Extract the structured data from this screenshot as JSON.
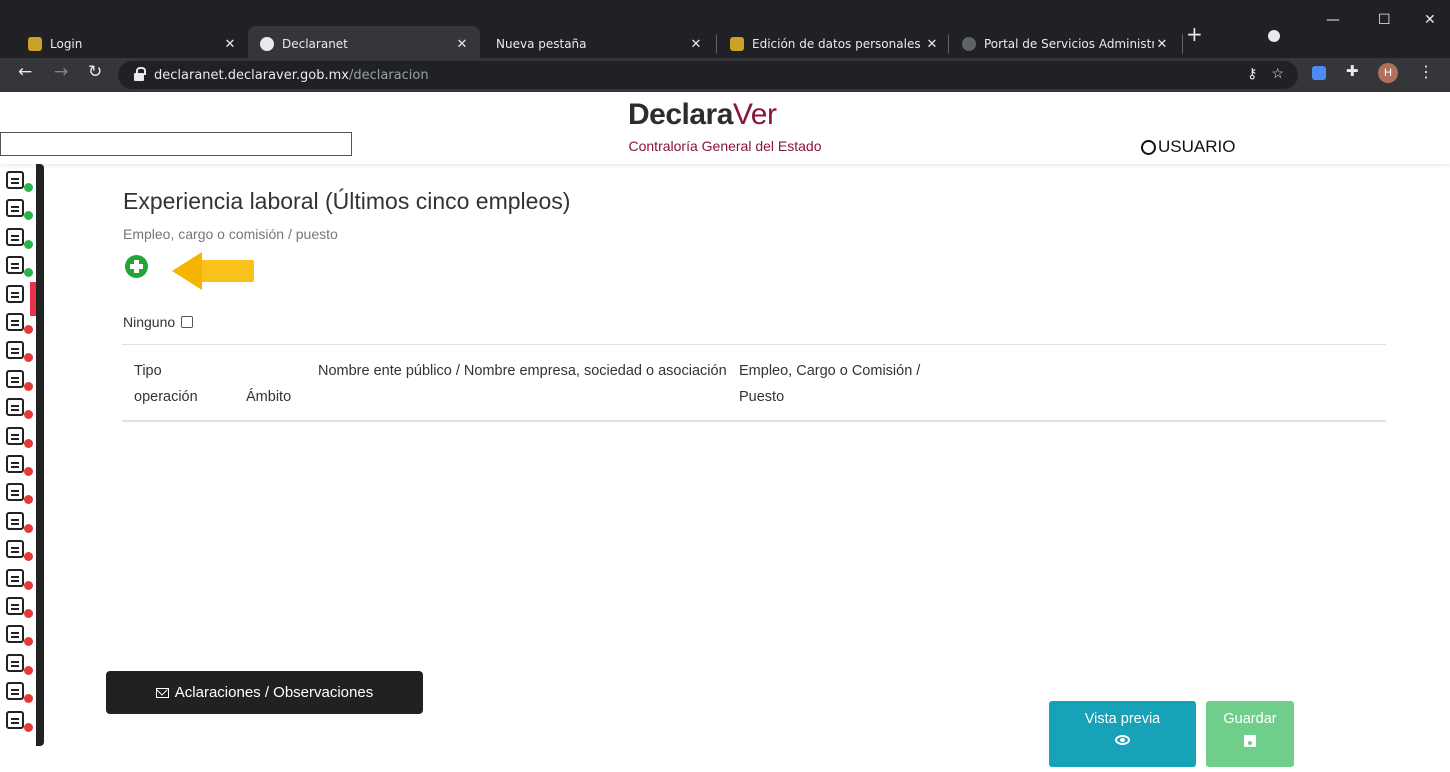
{
  "browser": {
    "tabs": [
      {
        "title": "Login",
        "active": false
      },
      {
        "title": "Declaranet",
        "active": true
      },
      {
        "title": "Nueva pestaña",
        "active": false
      },
      {
        "title": "Edición de datos personales",
        "active": false
      },
      {
        "title": "Portal de Servicios Administra",
        "active": false
      }
    ],
    "url_host": "declaranet.declaraver.gob.mx",
    "url_path": "/declaracion",
    "profile_initial": "H"
  },
  "header": {
    "logo_bold": "Declara",
    "logo_light": "Ver",
    "subtitle": "Contraloría General del Estado",
    "user_label": "USUARIO"
  },
  "sidebar": {
    "items": [
      {
        "icon": "form-icon",
        "status": "ok"
      },
      {
        "icon": "home-icon",
        "status": "ok"
      },
      {
        "icon": "document-icon",
        "status": "ok"
      },
      {
        "icon": "building-icon",
        "status": "ok"
      },
      {
        "icon": "people-icon",
        "status": "active"
      },
      {
        "icon": "family-icon",
        "status": "err"
      },
      {
        "icon": "edit-doc-icon",
        "status": "err"
      },
      {
        "icon": "id-card-icon",
        "status": "err"
      },
      {
        "icon": "house-icon",
        "status": "err"
      },
      {
        "icon": "car-icon",
        "status": "err"
      },
      {
        "icon": "chart-icon",
        "status": "err"
      },
      {
        "icon": "money-hand-icon",
        "status": "err"
      },
      {
        "icon": "truck-icon",
        "status": "err"
      },
      {
        "icon": "property-icon",
        "status": "err"
      },
      {
        "icon": "pie-icon",
        "status": "err"
      },
      {
        "icon": "network-icon",
        "status": "err"
      },
      {
        "icon": "globe-icon",
        "status": "err"
      },
      {
        "icon": "org-icon",
        "status": "err"
      },
      {
        "icon": "trend-icon",
        "status": "err"
      },
      {
        "icon": "user-group-icon",
        "status": "err"
      }
    ]
  },
  "main": {
    "title": "Experiencia laboral (Últimos cinco empleos)",
    "subtitle": "Empleo, cargo o comisión / puesto",
    "none_label": "Ninguno",
    "table_headers": [
      "Tipo operación",
      "Ámbito",
      "Nombre ente público / Nombre empresa, sociedad o asociación",
      "Empleo, Cargo o Comisión / Puesto"
    ]
  },
  "actions": {
    "observations_label": "Aclaraciones / Observaciones",
    "preview_label": "Vista previa",
    "save_label": "Guardar"
  },
  "colors": {
    "brand": "#8a1538",
    "add_green": "#21a635",
    "preview_teal": "#17a2b8",
    "save_green": "#6fcf8a",
    "arrow_yellow": "#f8c21a"
  }
}
